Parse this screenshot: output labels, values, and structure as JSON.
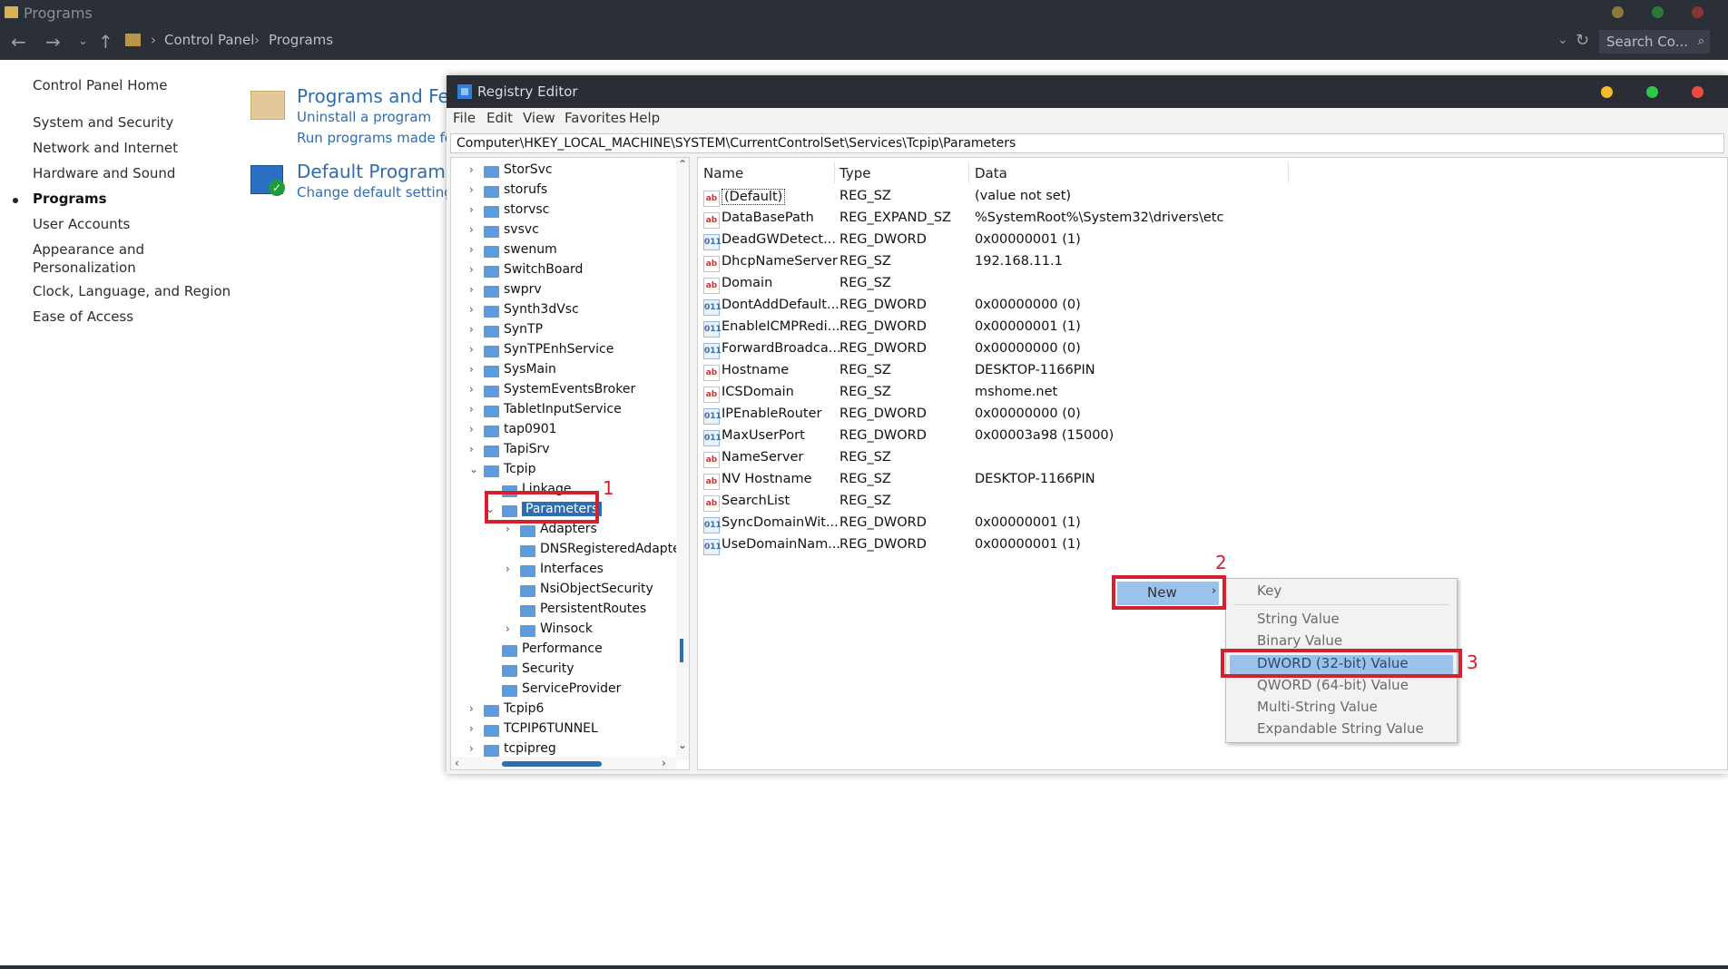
{
  "control_panel": {
    "title": "Programs",
    "breadcrumb": [
      "Control Panel",
      "Programs"
    ],
    "search_placeholder": "Search Co...",
    "sidebar": [
      "Control Panel Home",
      "System and Security",
      "Network and Internet",
      "Hardware and Sound",
      "Programs",
      "User Accounts",
      "Appearance and",
      "Personalization",
      "Clock, Language, and Region",
      "Ease of Access"
    ],
    "programs_heading": "Programs and Feat",
    "uninstall_link": "Uninstall a program",
    "run_programs_link": "Run programs made for",
    "default_heading": "Default Programs",
    "default_sub": "Change default settings f",
    "traffic_lights": [
      "#d8a72f",
      "#2fb34a",
      "#e0443e"
    ]
  },
  "registry": {
    "title": "Registry Editor",
    "menu": [
      "File",
      "Edit",
      "View",
      "Favorites",
      "Help"
    ],
    "path": "Computer\\HKEY_LOCAL_MACHINE\\SYSTEM\\CurrentControlSet\\Services\\Tcpip\\Parameters",
    "traffic_lights": [
      "#f4bd2e",
      "#2ec64b",
      "#ee4a44"
    ],
    "tree": [
      {
        "label": "StorSvc"
      },
      {
        "label": "storufs"
      },
      {
        "label": "storvsc"
      },
      {
        "label": "svsvc"
      },
      {
        "label": "swenum"
      },
      {
        "label": "SwitchBoard"
      },
      {
        "label": "swprv"
      },
      {
        "label": "Synth3dVsc"
      },
      {
        "label": "SynTP"
      },
      {
        "label": "SynTPEnhService"
      },
      {
        "label": "SysMain"
      },
      {
        "label": "SystemEventsBroker"
      },
      {
        "label": "TabletInputService"
      },
      {
        "label": "tap0901"
      },
      {
        "label": "TapiSrv"
      },
      {
        "label": "Tcpip"
      },
      {
        "label": "Linkage"
      },
      {
        "label": "Parameters"
      },
      {
        "label": "Adapters"
      },
      {
        "label": "DNSRegisteredAdapte"
      },
      {
        "label": "Interfaces"
      },
      {
        "label": "NsiObjectSecurity"
      },
      {
        "label": "PersistentRoutes"
      },
      {
        "label": "Winsock"
      },
      {
        "label": "Performance"
      },
      {
        "label": "Security"
      },
      {
        "label": "ServiceProvider"
      },
      {
        "label": "Tcpip6"
      },
      {
        "label": "TCPIP6TUNNEL"
      },
      {
        "label": "tcpipreg"
      }
    ],
    "columns": [
      "Name",
      "Type",
      "Data"
    ],
    "values": [
      {
        "name": "(Default)",
        "type": "REG_SZ",
        "data": "(value not set)",
        "icon": "ab"
      },
      {
        "name": "DataBasePath",
        "type": "REG_EXPAND_SZ",
        "data": "%SystemRoot%\\System32\\drivers\\etc",
        "icon": "ab"
      },
      {
        "name": "DeadGWDetect...",
        "type": "REG_DWORD",
        "data": "0x00000001 (1)",
        "icon": "011"
      },
      {
        "name": "DhcpNameServer",
        "type": "REG_SZ",
        "data": "192.168.11.1",
        "icon": "ab"
      },
      {
        "name": "Domain",
        "type": "REG_SZ",
        "data": "",
        "icon": "ab"
      },
      {
        "name": "DontAddDefault...",
        "type": "REG_DWORD",
        "data": "0x00000000 (0)",
        "icon": "011"
      },
      {
        "name": "EnableICMPRedi...",
        "type": "REG_DWORD",
        "data": "0x00000001 (1)",
        "icon": "011"
      },
      {
        "name": "ForwardBroadca...",
        "type": "REG_DWORD",
        "data": "0x00000000 (0)",
        "icon": "011"
      },
      {
        "name": "Hostname",
        "type": "REG_SZ",
        "data": "DESKTOP-1166PIN",
        "icon": "ab"
      },
      {
        "name": "ICSDomain",
        "type": "REG_SZ",
        "data": "mshome.net",
        "icon": "ab"
      },
      {
        "name": "IPEnableRouter",
        "type": "REG_DWORD",
        "data": "0x00000000 (0)",
        "icon": "011"
      },
      {
        "name": "MaxUserPort",
        "type": "REG_DWORD",
        "data": "0x00003a98 (15000)",
        "icon": "011"
      },
      {
        "name": "NameServer",
        "type": "REG_SZ",
        "data": "",
        "icon": "ab"
      },
      {
        "name": "NV Hostname",
        "type": "REG_SZ",
        "data": "DESKTOP-1166PIN",
        "icon": "ab"
      },
      {
        "name": "SearchList",
        "type": "REG_SZ",
        "data": "",
        "icon": "ab"
      },
      {
        "name": "SyncDomainWit...",
        "type": "REG_DWORD",
        "data": "0x00000001 (1)",
        "icon": "011"
      },
      {
        "name": "UseDomainNam...",
        "type": "REG_DWORD",
        "data": "0x00000001 (1)",
        "icon": "011"
      }
    ],
    "context_menu": {
      "new_label": "New",
      "submenu": [
        "Key",
        "String Value",
        "Binary Value",
        "DWORD (32-bit) Value",
        "QWORD (64-bit) Value",
        "Multi-String Value",
        "Expandable String Value"
      ]
    },
    "annotations": [
      "1",
      "2",
      "3"
    ],
    "annotation_color": "#d3222f"
  }
}
